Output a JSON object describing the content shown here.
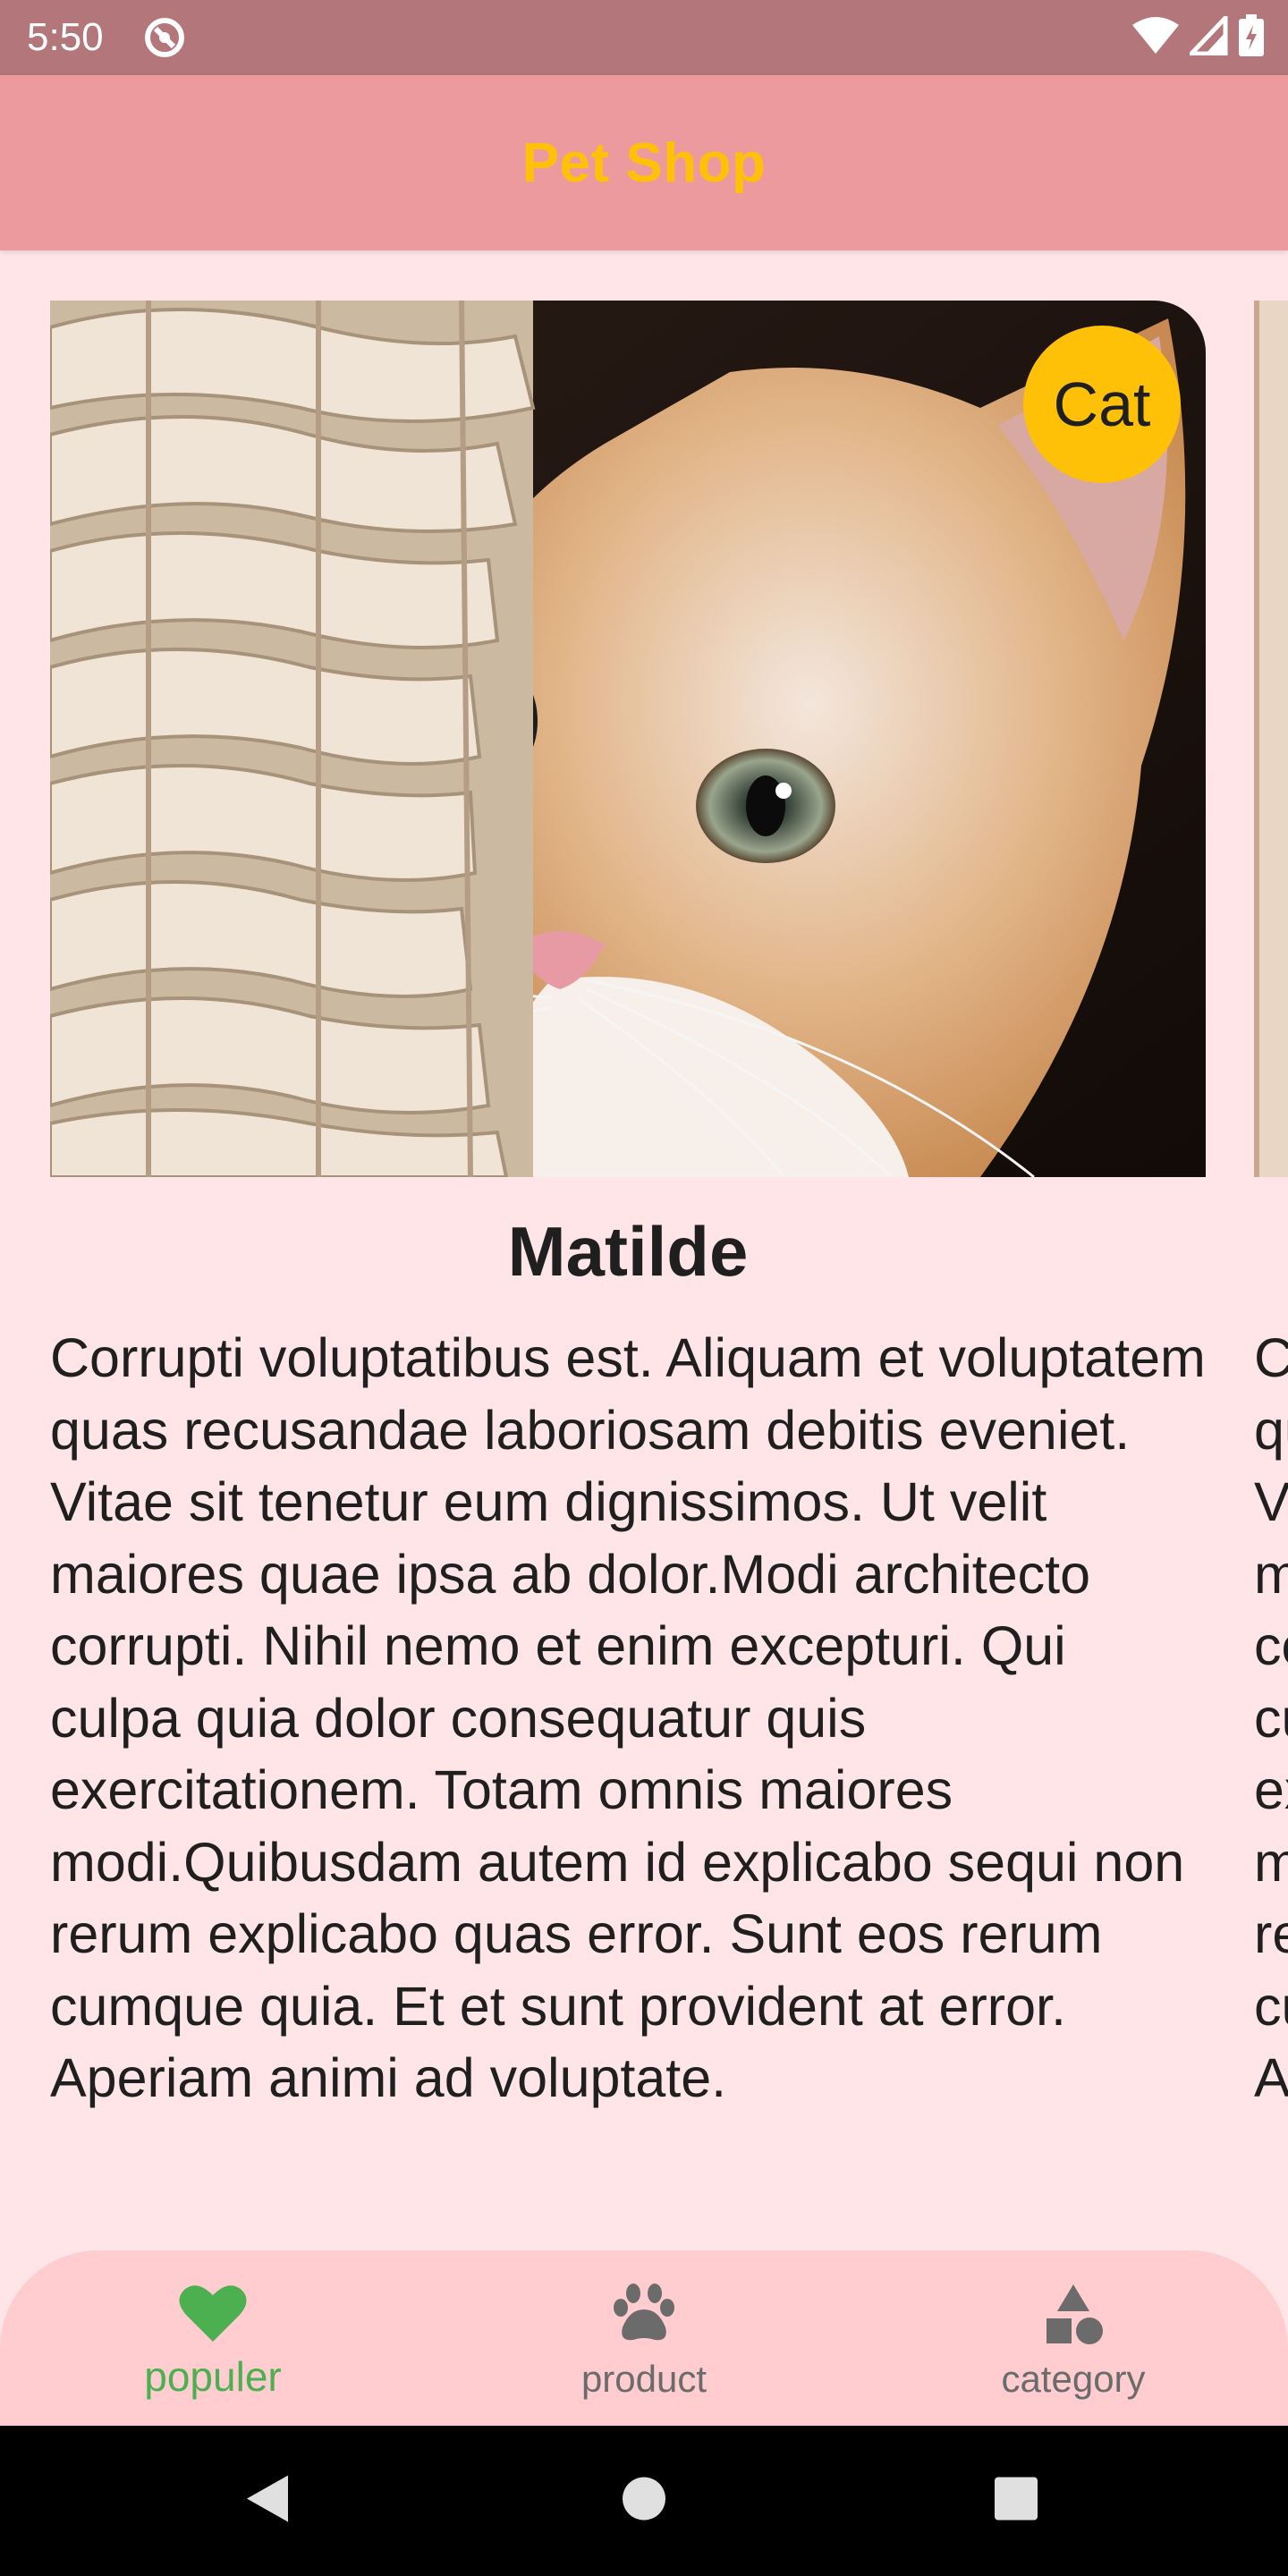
{
  "status_bar": {
    "time": "5:50"
  },
  "app_bar": {
    "title": "Pet Shop"
  },
  "card": {
    "category": "Cat",
    "name": "Matilde",
    "description": "Corrupti voluptatibus est. Aliquam et voluptatem quas recusandae laboriosam debitis eveniet. Vitae sit tenetur eum dignissimos. Ut velit maiores quae ipsa ab dolor.Modi architecto corrupti. Nihil nemo et enim excepturi. Qui culpa quia dolor consequatur quis exercitationem. Totam omnis maiores modi.Quibusdam autem id explicabo sequi non rerum explicabo quas error. Sunt eos rerum cumque quia. Et et sunt provident at error. Aperiam animi ad voluptate."
  },
  "bottom_nav": {
    "items": [
      {
        "label": "populer",
        "icon": "heart-icon",
        "active": true
      },
      {
        "label": "product",
        "icon": "paw-icon",
        "active": false
      },
      {
        "label": "category",
        "icon": "shapes-icon",
        "active": false
      }
    ],
    "active_color": "#4caf50",
    "inactive_color": "#6b6b6b"
  },
  "colors": {
    "status_bar": "#b3767a",
    "app_bar": "#ec9a9e",
    "title": "#ffc107",
    "background": "#ffe5e7",
    "bottom_nav": "#ffcdd0",
    "badge": "#ffc107"
  }
}
